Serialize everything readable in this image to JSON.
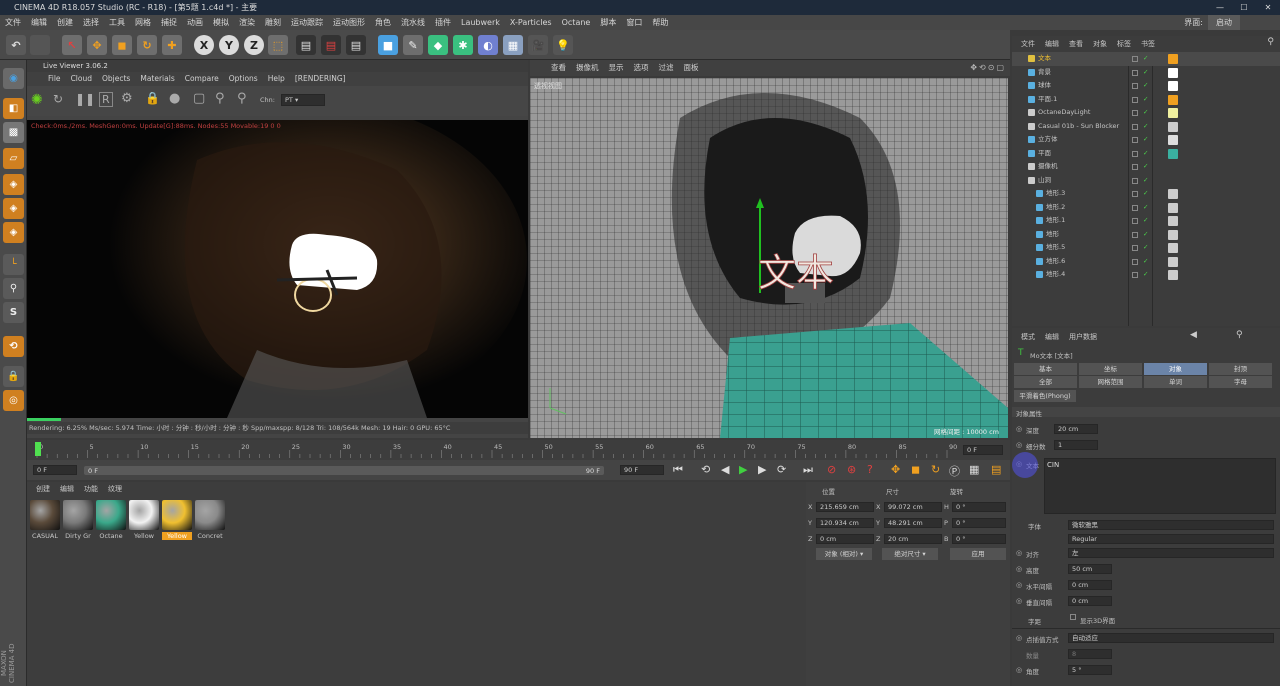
{
  "titlebar": {
    "title": "CINEMA 4D R18.057 Studio (RC - R18) - [第5题 1.c4d *] - 主要"
  },
  "menubar": {
    "items": [
      "文件",
      "编辑",
      "创建",
      "选择",
      "工具",
      "网格",
      "捕捉",
      "动画",
      "模拟",
      "渲染",
      "雕刻",
      "运动跟踪",
      "运动图形",
      "角色",
      "流水线",
      "插件",
      "Laubwerk",
      "X-Particles",
      "Octane",
      "脚本",
      "窗口",
      "帮助"
    ],
    "layout_label": "界面:",
    "layout_value": "启动"
  },
  "liveviewer": {
    "title": "Live Viewer 3.06.2",
    "menu": [
      "File",
      "Cloud",
      "Objects",
      "Materials",
      "Compare",
      "Options",
      "Help",
      "[RENDERING]"
    ],
    "chn_label": "Chn:",
    "chn_value": "PT",
    "check_text": "Check:0ms./2ms. MeshGen:0ms. Update[G]:88ms. Nodes:55 Movable:19 0 0",
    "status": "Rendering: 6.25%   Ms/sec: 5.974   Time: 小时 : 分钟 : 秒/小时 : 分钟 : 秒   Spp/maxspp: 8/128   Tri: 108/564k   Mesh: 19   Hair: 0   GPU:    65°C"
  },
  "viewport": {
    "menu": [
      "查看",
      "摄像机",
      "显示",
      "选项",
      "过滤",
      "面板"
    ],
    "label": "透视视图",
    "grid": "网格间距 : 10000 cm",
    "text3d": "文本"
  },
  "timeline": {
    "ticks": [
      "0",
      "5",
      "10",
      "15",
      "20",
      "25",
      "30",
      "35",
      "40",
      "45",
      "50",
      "55",
      "60",
      "65",
      "70",
      "75",
      "80",
      "85",
      "90"
    ],
    "frame_display": "0 F"
  },
  "transport": {
    "start": "0 F",
    "range_start": "0 F",
    "range_end": "90 F",
    "end": "90 F"
  },
  "materials": {
    "menu": [
      "创建",
      "编辑",
      "功能",
      "纹理"
    ],
    "items": [
      {
        "label": "CASUAL",
        "color": "#5a4a3a"
      },
      {
        "label": "Dirty Gr",
        "color": "#7a7a7a"
      },
      {
        "label": "Octane",
        "color": "#3aa88a"
      },
      {
        "label": "Yellow",
        "color": "#f2f2f2"
      },
      {
        "label": "Yellow",
        "color": "#f0c030"
      },
      {
        "label": "Concret",
        "color": "#8a8a8a"
      }
    ]
  },
  "coords": {
    "h_pos": "位置",
    "h_size": "尺寸",
    "h_rot": "旋转",
    "x": "215.659 cm",
    "y": "120.934 cm",
    "z": "0 cm",
    "sx": "99.072 cm",
    "sy": "48.291 cm",
    "sz": "20 cm",
    "h": "0 °",
    "p": "0 °",
    "b": "0 °",
    "mode1": "对象 (相对)",
    "mode2": "绝对尺寸",
    "apply": "应用"
  },
  "objmgr": {
    "menu": [
      "文件",
      "编辑",
      "查看",
      "对象",
      "标签",
      "书签"
    ],
    "rows": [
      {
        "name": "文本",
        "color": "#e0c040",
        "indent": 0,
        "sel": true
      },
      {
        "name": "背景",
        "color": "#5ab0e0",
        "indent": 0
      },
      {
        "name": "球体",
        "color": "#5ab0e0",
        "indent": 0
      },
      {
        "name": "平面.1",
        "color": "#5ab0e0",
        "indent": 0
      },
      {
        "name": "OctaneDayLight",
        "color": "#cccccc",
        "indent": 0
      },
      {
        "name": "Casual 01b - Sun Blocker",
        "color": "#cccccc",
        "indent": 0
      },
      {
        "name": "立方体",
        "color": "#5ab0e0",
        "indent": 0
      },
      {
        "name": "平面",
        "color": "#5ab0e0",
        "indent": 0
      },
      {
        "name": "摄像机",
        "color": "#cccccc",
        "indent": 0
      },
      {
        "name": "山洞",
        "color": "#cccccc",
        "indent": 0
      },
      {
        "name": "地形.3",
        "color": "#5ab0e0",
        "indent": 1
      },
      {
        "name": "地形.2",
        "color": "#5ab0e0",
        "indent": 1
      },
      {
        "name": "地形.1",
        "color": "#5ab0e0",
        "indent": 1
      },
      {
        "name": "地形",
        "color": "#5ab0e0",
        "indent": 1
      },
      {
        "name": "地形.5",
        "color": "#5ab0e0",
        "indent": 1
      },
      {
        "name": "地形.6",
        "color": "#5ab0e0",
        "indent": 1
      },
      {
        "name": "地形.4",
        "color": "#5ab0e0",
        "indent": 1
      }
    ]
  },
  "attrmgr": {
    "menu": [
      "模式",
      "编辑",
      "用户数据"
    ],
    "title": "Mo文本 [文本]",
    "tabs_row1": [
      "基本",
      "坐标",
      "对象",
      "封顶"
    ],
    "tabs_row2": [
      "全部",
      "网格范围",
      "单词",
      "字母"
    ],
    "tab_phong": "平滑着色(Phong)",
    "section": "对象属性",
    "depth_label": "深度",
    "depth": "20 cm",
    "subdiv_label": "细分数",
    "subdiv": "1",
    "text_label": "文本",
    "text_value": "CIN",
    "font_label": "字体",
    "font": "微软雅黑",
    "font_style": "Regular",
    "align_label": "对齐",
    "align": "左",
    "height_label": "高度",
    "height": "50 cm",
    "hspace_label": "水平间隔",
    "hspace": "0 cm",
    "vspace_label": "垂直间隔",
    "vspace": "0 cm",
    "kerning_label": "字距",
    "show3d": "显示3D界面",
    "interp_label": "点插值方式",
    "interp": "自动适应",
    "count_label": "数量",
    "count": "8",
    "angle_label": "角度",
    "angle": "5 °"
  }
}
